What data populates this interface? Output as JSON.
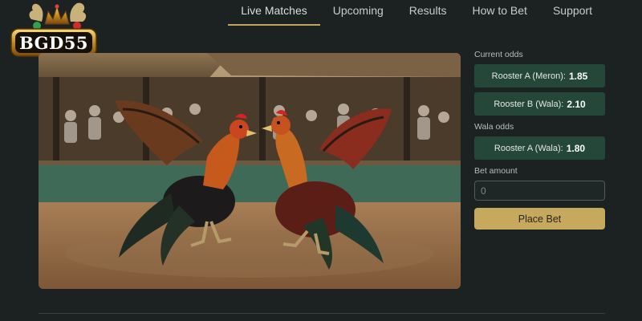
{
  "brand": {
    "logo_text": "BGD55"
  },
  "nav": {
    "items": [
      {
        "label": "Live Matches",
        "active": true
      },
      {
        "label": "Upcoming",
        "active": false
      },
      {
        "label": "Results",
        "active": false
      },
      {
        "label": "How to Bet",
        "active": false
      },
      {
        "label": "Support",
        "active": false
      }
    ]
  },
  "hero": {
    "image_alt": "Two roosters fighting in an arena"
  },
  "panel": {
    "current_odds_label": "Current odds",
    "current_odds": [
      {
        "label": "Rooster A (Meron):",
        "value": "1.85"
      },
      {
        "label": "Rooster B (Wala):",
        "value": "2.10"
      }
    ],
    "wala_odds_label": "Wala odds",
    "wala_odds": [
      {
        "label": "Rooster A (Wala):",
        "value": "1.80"
      }
    ],
    "bet_amount_label": "Bet amount",
    "bet_amount_placeholder": "0",
    "place_bet_label": "Place Bet"
  },
  "colors": {
    "accent": "#c7a95e",
    "odds_button": "#24473a",
    "background": "#1c2221"
  }
}
